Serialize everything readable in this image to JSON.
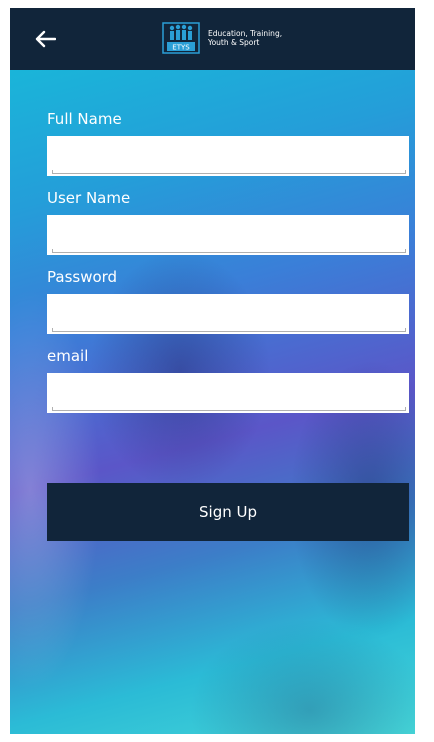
{
  "header": {
    "back_icon": "arrow-left-icon",
    "logo_text": "ETYS",
    "brand_line1": "Education, Training,",
    "brand_line2": "Youth & Sport"
  },
  "form": {
    "full_name": {
      "label": "Full Name",
      "value": "",
      "placeholder": ""
    },
    "user_name": {
      "label": "User Name",
      "value": "",
      "placeholder": ""
    },
    "password": {
      "label": "Password",
      "value": "",
      "placeholder": ""
    },
    "email": {
      "label": "email",
      "value": "",
      "placeholder": ""
    },
    "submit_label": "Sign Up"
  },
  "colors": {
    "appbar": "#11253a",
    "button": "#11253a",
    "background_start": "#1ab5d9",
    "background_mid": "#5b56c8",
    "background_end": "#45d6d8"
  }
}
